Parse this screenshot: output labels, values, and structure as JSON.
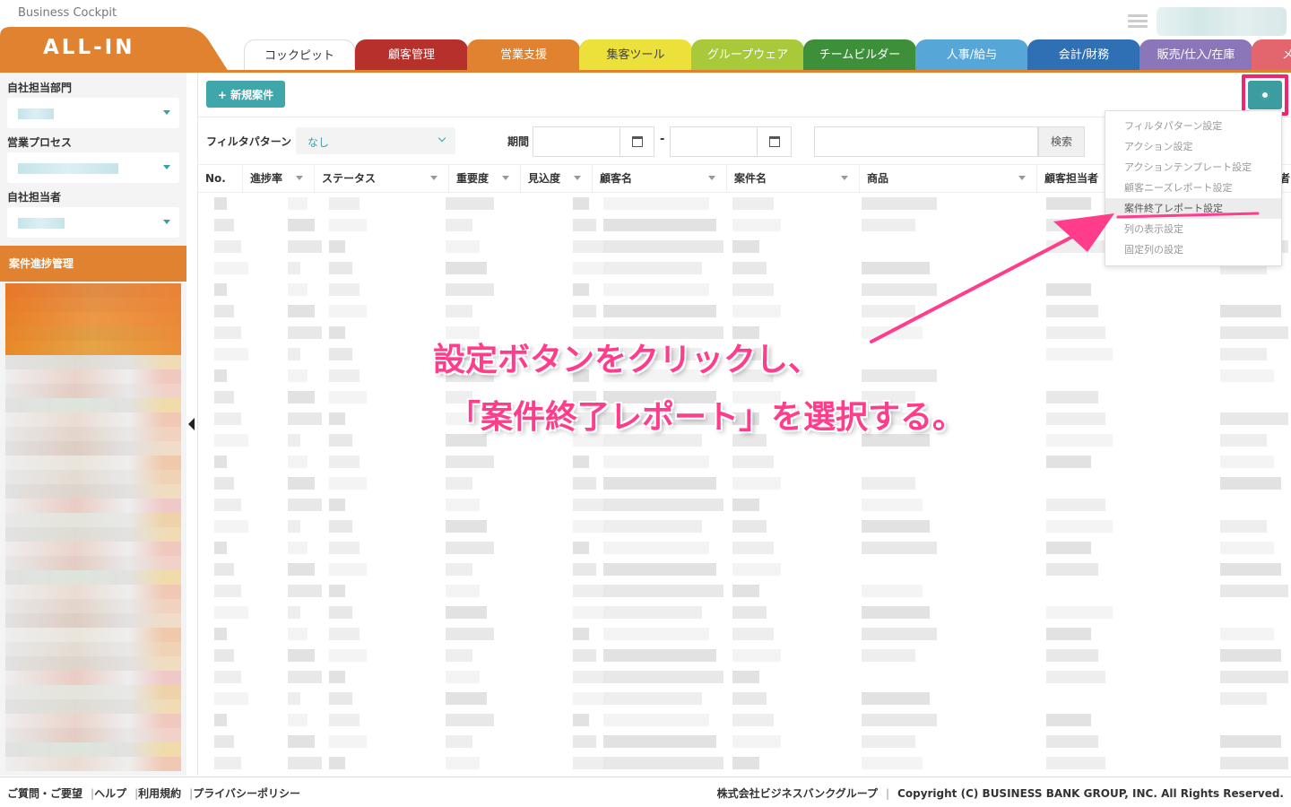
{
  "app": {
    "caption": "Business Cockpit",
    "logo": "ALL-IN"
  },
  "tabs": [
    {
      "label": "コックピット",
      "color": "#ffffff",
      "text": "#333333"
    },
    {
      "label": "顧客管理",
      "color": "#b7312c",
      "text": "#ffffff"
    },
    {
      "label": "営業支援",
      "color": "#e0822f",
      "text": "#ffffff"
    },
    {
      "label": "集客ツール",
      "color": "#ece13b",
      "text": "#444444"
    },
    {
      "label": "グループウェア",
      "color": "#a8c93a",
      "text": "#ffffff"
    },
    {
      "label": "チームビルダー",
      "color": "#3e8f3a",
      "text": "#ffffff"
    },
    {
      "label": "人事/給与",
      "color": "#56a7d8",
      "text": "#ffffff"
    },
    {
      "label": "会計/財務",
      "color": "#2f6fb3",
      "text": "#ffffff"
    },
    {
      "label": "販売/仕入/在庫",
      "color": "#8a76b8",
      "text": "#ffffff"
    },
    {
      "label": "メ",
      "color": "#e3666f",
      "text": "#ffffff"
    }
  ],
  "sidebar": {
    "dept_label": "自社担当部門",
    "process_label": "営業プロセス",
    "person_label": "自社担当者",
    "section_title": "案件進捗管理"
  },
  "toolbar": {
    "new_button": "新規案件"
  },
  "filter": {
    "pattern_label": "フィルタパターン",
    "pattern_value": "なし",
    "period_label": "期間",
    "dash": "-",
    "search_button": "検索"
  },
  "table": {
    "columns": [
      "No.",
      "進捗率",
      "ステータス",
      "重要度",
      "見込度",
      "顧客名",
      "案件名",
      "商品",
      "顧客担当者",
      "者"
    ]
  },
  "settings_menu": {
    "items": [
      "フィルタパターン設定",
      "アクション設定",
      "アクションテンプレート設定",
      "顧客ニーズレポート設定",
      "案件終了レポート設定",
      "列の表示設定",
      "固定列の設定"
    ],
    "selected_index": 4
  },
  "annotation": {
    "line1": "設定ボタンをクリックし、",
    "line2": "「案件終了レポート」を選択する。",
    "color": "#ff3d8b"
  },
  "footer": {
    "links": [
      "ご質問・ご要望",
      "ヘルプ",
      "利用規約",
      "プライバシーポリシー"
    ],
    "company": "株式会社ビジネスバンクグループ",
    "copyright": "Copyright (C) BUSINESS BANK GROUP, INC. All Rights Reserved."
  }
}
